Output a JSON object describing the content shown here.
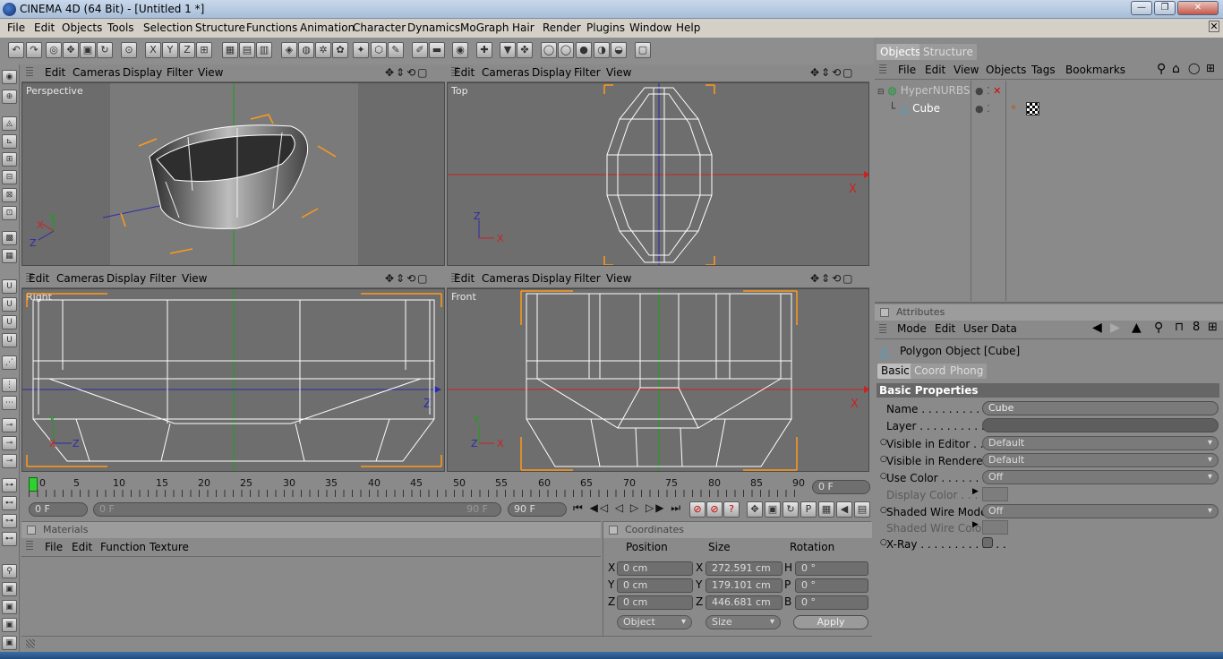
{
  "app": {
    "title": "CINEMA 4D (64 Bit) - [Untitled 1 *]",
    "min": "—",
    "max": "❐",
    "close": "✕"
  },
  "menu": [
    "File",
    "Edit",
    "Objects",
    "Tools",
    "Selection",
    "Structure",
    "Functions",
    "Animation",
    "Character",
    "Dynamics",
    "MoGraph",
    "Hair",
    "Render",
    "Plugins",
    "Window",
    "Help"
  ],
  "viewport_menu": {
    "edit": "Edit",
    "cameras": "Cameras",
    "display": "Display",
    "filter": "Filter",
    "view": "View",
    "nav": "✥⇕⟲▢"
  },
  "viewports": {
    "perspective": "Perspective",
    "top": "Top",
    "right": "Right",
    "front": "Front"
  },
  "timeline": {
    "ticks": [
      "0",
      "5",
      "10",
      "15",
      "20",
      "25",
      "30",
      "35",
      "40",
      "45",
      "50",
      "55",
      "60",
      "65",
      "70",
      "75",
      "80",
      "85",
      "90"
    ],
    "current_frame": "0 F",
    "start": "0 F",
    "range_start": "0 F",
    "range_end": "90 F",
    "end": "90 F",
    "play_controls": "⏮ ◀◁ ◁ ▷ ▷▶ ⏭"
  },
  "materials": {
    "header": "Materials",
    "menu": [
      "File",
      "Edit",
      "Function",
      "Texture"
    ]
  },
  "coordinates": {
    "header": "Coordinates",
    "col_position": "Position",
    "col_size": "Size",
    "col_rotation": "Rotation",
    "rows": [
      {
        "axis": "X",
        "pos": "0 cm",
        "saxis": "X",
        "size": "272.591 cm",
        "raxis": "H",
        "rot": "0 °"
      },
      {
        "axis": "Y",
        "pos": "0 cm",
        "saxis": "Y",
        "size": "179.101 cm",
        "raxis": "P",
        "rot": "0 °"
      },
      {
        "axis": "Z",
        "pos": "0 cm",
        "saxis": "Z",
        "size": "446.681 cm",
        "raxis": "B",
        "rot": "0 °"
      }
    ],
    "mode1": "Object",
    "mode2": "Size",
    "apply": "Apply"
  },
  "objects": {
    "tabs": [
      "Objects",
      "Structure"
    ],
    "menu": [
      "File",
      "Edit",
      "View",
      "Objects",
      "Tags",
      "Bookmarks"
    ],
    "tree": [
      {
        "name": "HyperNURBS"
      },
      {
        "name": "Cube"
      }
    ]
  },
  "attributes": {
    "header": "Attributes",
    "menu": [
      "Mode",
      "Edit",
      "User Data"
    ],
    "object_title": "Polygon Object [Cube]",
    "tabs": [
      "Basic",
      "Coord.",
      "Phong"
    ],
    "section": "Basic Properties",
    "name_label": "Name . . . . . . . . . . . . .",
    "name_value": "Cube",
    "layer_label": "Layer . . . . . . . . . . . . .",
    "vis_editor_label": "Visible in Editor . . . . .",
    "vis_editor_value": "Default",
    "vis_render_label": "Visible in Renderer . . .",
    "vis_render_value": "Default",
    "use_color_label": "Use Color . . . . . . . . .",
    "use_color_value": "Off",
    "display_color_label": "Display Color . . . . .",
    "wire_mode_label": "Shaded Wire Mode",
    "wire_mode_value": "Off",
    "wire_color_label": "Shaded Wire Color",
    "xray_label": "X-Ray . . . . . . . . . . . . ."
  },
  "colors": {
    "accent_orange": "#ff9a1a",
    "axis_red": "#cc2222",
    "axis_green": "#1aa01a",
    "axis_blue": "#2a2aaa"
  }
}
